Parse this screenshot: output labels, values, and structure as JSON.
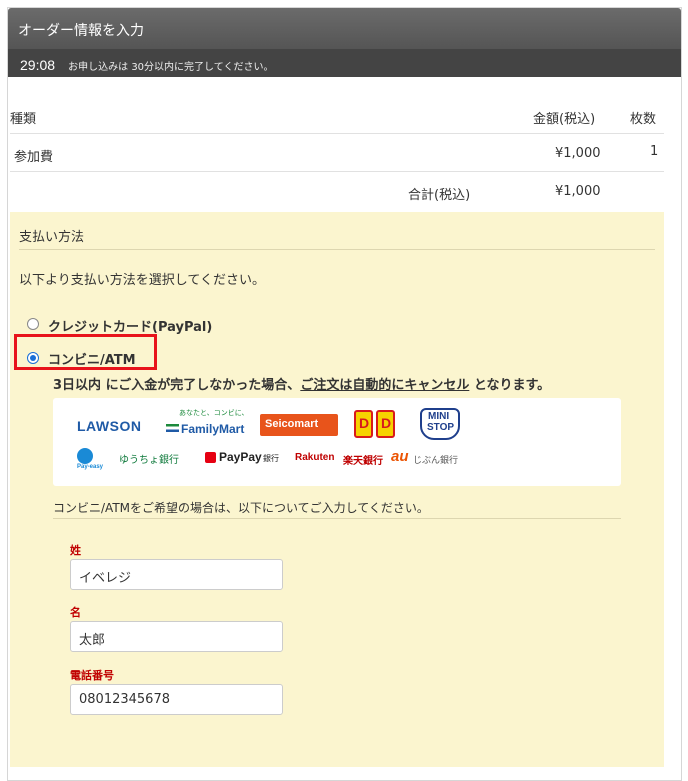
{
  "header": {
    "title": "オーダー情報を入力"
  },
  "timer": {
    "time": "29:08",
    "note": "お申し込みは 30分以内に完了してください。"
  },
  "table": {
    "headers": {
      "type": "種類",
      "amount": "金額(税込)",
      "count": "枚数"
    },
    "rows": [
      {
        "type": "参加費",
        "amount": "¥1,000",
        "count": "1"
      }
    ],
    "total_label": "合計(税込)",
    "total_amount": "¥1,000"
  },
  "payment": {
    "title": "支払い方法",
    "instruction": "以下より支払い方法を選択してください。",
    "options": [
      {
        "label": "クレジットカード(PayPal)",
        "selected": false
      },
      {
        "label": "コンビニ/ATM",
        "selected": true
      }
    ],
    "warning_prefix": "3日以内 にご入金が完了しなかった場合、",
    "warning_link": "ご注文は自動的にキャンセル",
    "warning_suffix": " となります。",
    "logos": {
      "lawson": "LAWSON",
      "familymart_tag": "あなたと、コンビに、",
      "familymart": "FamilyMart",
      "seicomart": "Seicomart",
      "daily": "D",
      "ministop_1": "MINI",
      "ministop_2": "STOP",
      "payeasy": "Pay-easy",
      "yucho": "ゆうちょ銀行",
      "paypay": "PayPay",
      "paypay_suffix": "銀行",
      "rakuten": "Rakuten",
      "rakuten_suffix": "楽天銀行",
      "au": "au",
      "au_suffix": "じぶん銀行"
    },
    "sub_instruction": "コンビニ/ATMをご希望の場合は、以下についてご入力してください。",
    "fields": [
      {
        "label": "姓",
        "value": "イベレジ"
      },
      {
        "label": "名",
        "value": "太郎"
      },
      {
        "label": "電話番号",
        "value": "08012345678"
      }
    ]
  },
  "colors": {
    "header_bg": "#5e5e5e",
    "timer_bg": "#444444",
    "payment_bg": "#fbf5cf",
    "highlight": "#e8141b",
    "field_label": "#c00000",
    "radio": "#1a6fd6"
  }
}
